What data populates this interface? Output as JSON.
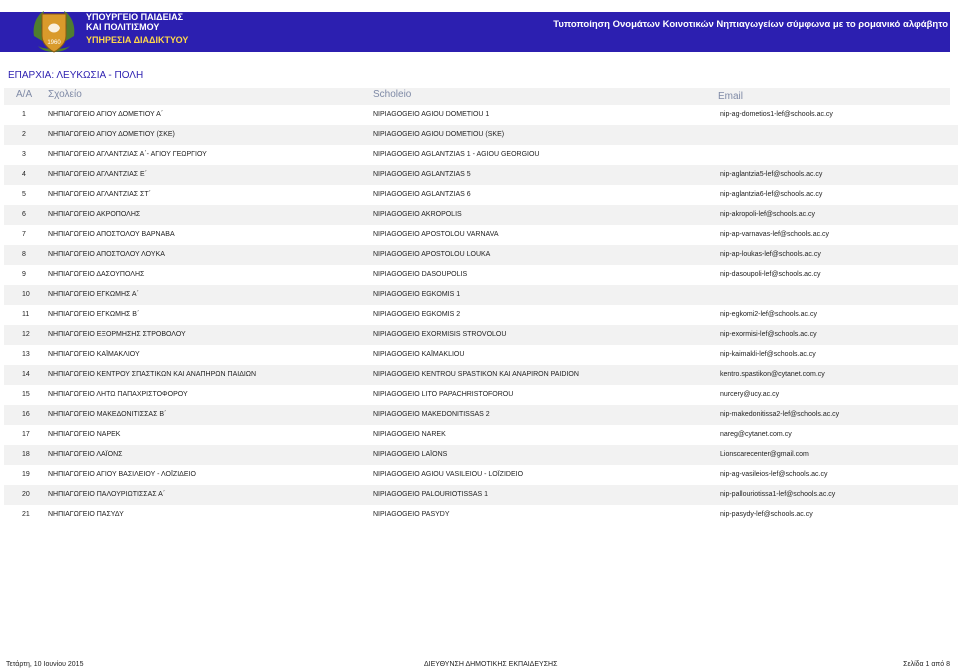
{
  "header": {
    "ministry_line1": "ΥΠΟΥΡΓΕΙΟ ΠΑΙΔΕΙΑΣ",
    "ministry_line2": "ΚΑΙ ΠΟΛΙΤΙΣΜΟΥ",
    "service": "ΥΠΗΡΕΣΙΑ ΔΙΑΔΙΚΤΥΟΥ",
    "project_title": "Τυποποίηση Ονομάτων Κοινοτικών Νηπιαγωγείων σύμφωνα με το ρομανικό αλφάβητο",
    "emblem_icon": "cyprus-coat-of-arms-icon"
  },
  "district": "ΕΠΑΡΧΙΑ:  ΛΕΥΚΩΣΙΑ - ΠΟΛΗ",
  "columns": {
    "index": "Α/Α",
    "school": "Σχολείο",
    "scholeio": "Scholeio",
    "email": "Email"
  },
  "rows": [
    {
      "n": "1",
      "name": "ΝΗΠΙΑΓΩΓΕΙΟ ΑΓΙΟΥ ΔΟΜΕΤΙΟΥ Α΄",
      "latin": "NIPIAGOGEIO AGIOU DOMETIOU 1",
      "email": "nip-ag-dometios1-lef@schools.ac.cy"
    },
    {
      "n": "2",
      "name": "ΝΗΠΙΑΓΩΓΕΙΟ ΑΓΙΟΥ ΔΟΜΕΤΙΟΥ (ΣΚΕ)",
      "latin": "NIPIAGOGEIO AGIOU DOMETIOU (SKE)",
      "email": ""
    },
    {
      "n": "3",
      "name": "ΝΗΠΙΑΓΩΓΕΙΟ ΑΓΛΑΝΤΖΙΑΣ Α΄- ΑΓΙΟΥ ΓΕΩΡΓΙΟΥ",
      "latin": "NIPIAGOGEIO AGLANTZIAS 1 - AGIOU GEORGIOU",
      "email": ""
    },
    {
      "n": "4",
      "name": "ΝΗΠΙΑΓΩΓΕΙΟ ΑΓΛΑΝΤΖΙΑΣ Ε΄",
      "latin": "NIPIAGOGEIO AGLANTZIAS 5",
      "email": "nip-aglantzia5-lef@schools.ac.cy"
    },
    {
      "n": "5",
      "name": "ΝΗΠΙΑΓΩΓΕΙΟ ΑΓΛΑΝΤΖΙΑΣ ΣΤ΄",
      "latin": "NIPIAGOGEIO AGLANTZIAS 6",
      "email": "nip-aglantzia6-lef@schools.ac.cy"
    },
    {
      "n": "6",
      "name": "ΝΗΠΙΑΓΩΓΕΙΟ ΑΚΡΟΠΟΛΗΣ",
      "latin": "NIPIAGOGEIO AKROPOLIS",
      "email": "nip-akropoli-lef@schools.ac.cy"
    },
    {
      "n": "7",
      "name": "ΝΗΠΙΑΓΩΓΕΙΟ ΑΠΟΣΤΟΛΟΥ ΒΑΡΝΑΒΑ",
      "latin": "NIPIAGOGEIO APOSTOLOU VARNAVA",
      "email": "nip-ap-varnavas-lef@schools.ac.cy"
    },
    {
      "n": "8",
      "name": "ΝΗΠΙΑΓΩΓΕΙΟ ΑΠΟΣΤΟΛΟΥ ΛΟΥΚΑ",
      "latin": "NIPIAGOGEIO APOSTOLOU LOUKA",
      "email": "nip-ap-loukas-lef@schools.ac.cy"
    },
    {
      "n": "9",
      "name": "ΝΗΠΙΑΓΩΓΕΙΟ ΔΑΣΟΥΠΟΛΗΣ",
      "latin": "NIPIAGOGEIO DASOUPOLIS",
      "email": "nip-dasoupoli-lef@schools.ac.cy"
    },
    {
      "n": "10",
      "name": "ΝΗΠΙΑΓΩΓΕΙΟ ΕΓΚΩΜΗΣ Α΄",
      "latin": "NIPIAGOGEIO EGKOMIS 1",
      "email": ""
    },
    {
      "n": "11",
      "name": "ΝΗΠΙΑΓΩΓΕΙΟ ΕΓΚΩΜΗΣ Β΄",
      "latin": "NIPIAGOGEIO EGKOMIS 2",
      "email": "nip-egkomi2-lef@schools.ac.cy"
    },
    {
      "n": "12",
      "name": "ΝΗΠΙΑΓΩΓΕΙΟ ΕΞΟΡΜΗΣΗΣ ΣΤΡΟΒΟΛΟΥ",
      "latin": "NIPIAGOGEIO EXORMISIS STROVOLOU",
      "email": "nip-exormisi-lef@schools.ac.cy"
    },
    {
      "n": "13",
      "name": "ΝΗΠΙΑΓΩΓΕΙΟ ΚΑΪΜΑΚΛΙΟΥ",
      "latin": "NIPIAGOGEIO KAÏMAKLIOU",
      "email": "nip-kaimakli-lef@schools.ac.cy"
    },
    {
      "n": "14",
      "name": "ΝΗΠΙΑΓΩΓΕΙΟ ΚΕΝΤΡΟΥ ΣΠΑΣΤΙΚΩΝ ΚΑΙ ΑΝΑΠΗΡΩΝ ΠΑΙΔΙΩΝ",
      "latin": "NIPIAGOGEIO KENTROU SPASTIKON KAI ANAPIRON PAIDION",
      "email": "kentro.spastikon@cytanet.com.cy"
    },
    {
      "n": "15",
      "name": "ΝΗΠΙΑΓΩΓΕΙΟ ΛΗΤΩ ΠΑΠΑΧΡΙΣΤΟΦΟΡΟΥ",
      "latin": "NIPIAGOGEIO LITO PAPACHRISTOFOROU",
      "email": "nurcery@ucy.ac.cy"
    },
    {
      "n": "16",
      "name": "ΝΗΠΙΑΓΩΓΕΙΟ ΜΑΚΕΔΟΝΙΤΙΣΣΑΣ Β΄",
      "latin": "NIPIAGOGEIO MAKEDONITISSAS 2",
      "email": "nip-makedonitissa2-lef@schools.ac.cy"
    },
    {
      "n": "17",
      "name": "ΝΗΠΙΑΓΩΓΕΙΟ ΝΑΡΕΚ",
      "latin": "NIPIAGOGEIO NAREK",
      "email": "nareg@cytanet.com.cy"
    },
    {
      "n": "18",
      "name": "ΝΗΠΙΑΓΩΓΕΙΟ ΛΑΪΟΝΣ",
      "latin": "NIPIAGOGEIO LAÏONS",
      "email": "Lionscarecenter@gmail.com"
    },
    {
      "n": "19",
      "name": "ΝΗΠΙΑΓΩΓΕΙΟ ΑΓΙΟΥ ΒΑΣΙΛΕΙΟΥ - ΛΟΪΖΙΔΕΙΟ",
      "latin": "NIPIAGOGEIO AGIOU VASILEIOU - LOÏZIDEIO",
      "email": "nip-ag-vasileios-lef@schools.ac.cy"
    },
    {
      "n": "20",
      "name": "ΝΗΠΙΑΓΩΓΕΙΟ ΠΑΛΟΥΡΙΩΤΙΣΣΑΣ Α΄",
      "latin": "NIPIAGOGEIO PALOURIOTISSAS 1",
      "email": "nip-pallouriotissa1-lef@schools.ac.cy"
    },
    {
      "n": "21",
      "name": "ΝΗΠΙΑΓΩΓΕΙΟ ΠΑΣΥΔΥ",
      "latin": "NIPIAGOGEIO PASYDY",
      "email": "nip-pasydy-lef@schools.ac.cy"
    }
  ],
  "footer": {
    "date": "Τετάρτη, 10 Ιουνίου 2015",
    "department": "ΔΙΕΥΘΥΝΣΗ ΔΗΜΟΤΙΚΗΣ ΕΚΠΑΙΔΕΥΣΗΣ",
    "page": "Σελίδα 1 από 8"
  },
  "colors": {
    "banner": "#2c1fb0",
    "service_text": "#ffd84a",
    "header_text": "#7f8aa6",
    "stripe": "#f2f2f2"
  }
}
